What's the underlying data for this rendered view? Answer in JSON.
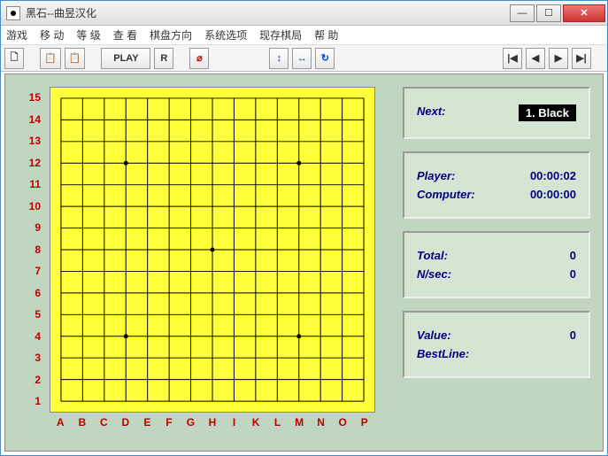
{
  "window": {
    "title": "黑石--曲昱汉化"
  },
  "menu": {
    "game": "游戏",
    "move": "移 动",
    "level": "等 级",
    "view": "查 看",
    "board_dir": "棋盘方向",
    "sys_opts": "系统选项",
    "save_board": "现存棋局",
    "help": "帮 助"
  },
  "toolbar": {
    "new": "🗋",
    "copy": "📋",
    "paste": "📋",
    "play": "PLAY",
    "r": "R",
    "stop": "⌀",
    "vflip": "↕",
    "hflip": "↔",
    "rotate": "↻",
    "first": "|◀",
    "prev": "◀",
    "next": "▶",
    "last": "▶|"
  },
  "board": {
    "rows": [
      "15",
      "14",
      "13",
      "12",
      "11",
      "10",
      "9",
      "8",
      "7",
      "6",
      "5",
      "4",
      "3",
      "2",
      "1"
    ],
    "cols": [
      "A",
      "B",
      "C",
      "D",
      "E",
      "F",
      "G",
      "H",
      "I",
      "K",
      "L",
      "M",
      "N",
      "O",
      "P"
    ]
  },
  "panel_next": {
    "label": "Next:",
    "value": "1. Black"
  },
  "panel_time": {
    "player_label": "Player:",
    "player_value": "00:00:02",
    "computer_label": "Computer:",
    "computer_value": "00:00:00"
  },
  "panel_stats": {
    "total_label": "Total:",
    "total_value": "0",
    "nsec_label": "N/sec:",
    "nsec_value": "0"
  },
  "panel_eval": {
    "value_label": "Value:",
    "value_value": "0",
    "bestline_label": "BestLine:",
    "bestline_value": ""
  }
}
